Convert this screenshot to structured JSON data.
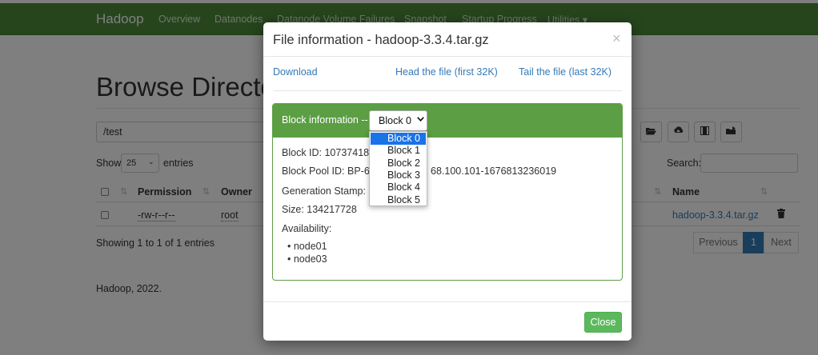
{
  "navbar": {
    "brand": "Hadoop",
    "links": [
      "Overview",
      "Datanodes",
      "Datanode Volume Failures",
      "Snapshot",
      "Startup Progress",
      "Utilities ▾"
    ]
  },
  "page": {
    "title": "Browse Directory",
    "path_value": "/test",
    "show_label": "Show",
    "entries_value": "25",
    "entries_label": "entries",
    "search_label": "Search:",
    "columns": {
      "permission": "Permission",
      "owner": "Owner",
      "name": "Name"
    },
    "rows": [
      {
        "permission": "-rw-r--r--",
        "owner": "root",
        "name": "hadoop-3.3.4.tar.gz"
      }
    ],
    "showing_text": "Showing 1 to 1 of 1 entries",
    "pagination": {
      "previous": "Previous",
      "page": "1",
      "next": "Next"
    },
    "footer": "Hadoop, 2022."
  },
  "modal": {
    "title": "File information - hadoop-3.3.4.tar.gz",
    "close_symbol": "×",
    "links": {
      "download": "Download",
      "head": "Head the file (first 32K)",
      "tail": "Tail the file (last 32K)"
    },
    "block_heading": "Block information --",
    "selected_block": "Block 0",
    "block_options": [
      "Block 0",
      "Block 1",
      "Block 2",
      "Block 3",
      "Block 4",
      "Block 5"
    ],
    "block_id": "Block ID: 1073741825",
    "block_pool_id": "Block Pool ID: BP-615...168.100.101-1676813236019",
    "block_pool_left": "Block Pool ID: BP-615",
    "block_pool_right": "68.100.101-1676813236019",
    "generation_stamp": "Generation Stamp: 1001",
    "generation_left": "Generation Stamp: 10",
    "size": "Size: 134217728",
    "availability_label": "Availability:",
    "availability": [
      "node01",
      "node03"
    ],
    "close_button": "Close"
  },
  "colors": {
    "navbar": "#4d8b3a",
    "panel_heading": "#5b9e43",
    "close_button": "#5cb85c",
    "link": "#337ab7",
    "dropdown_selected": "#1a73e8"
  }
}
